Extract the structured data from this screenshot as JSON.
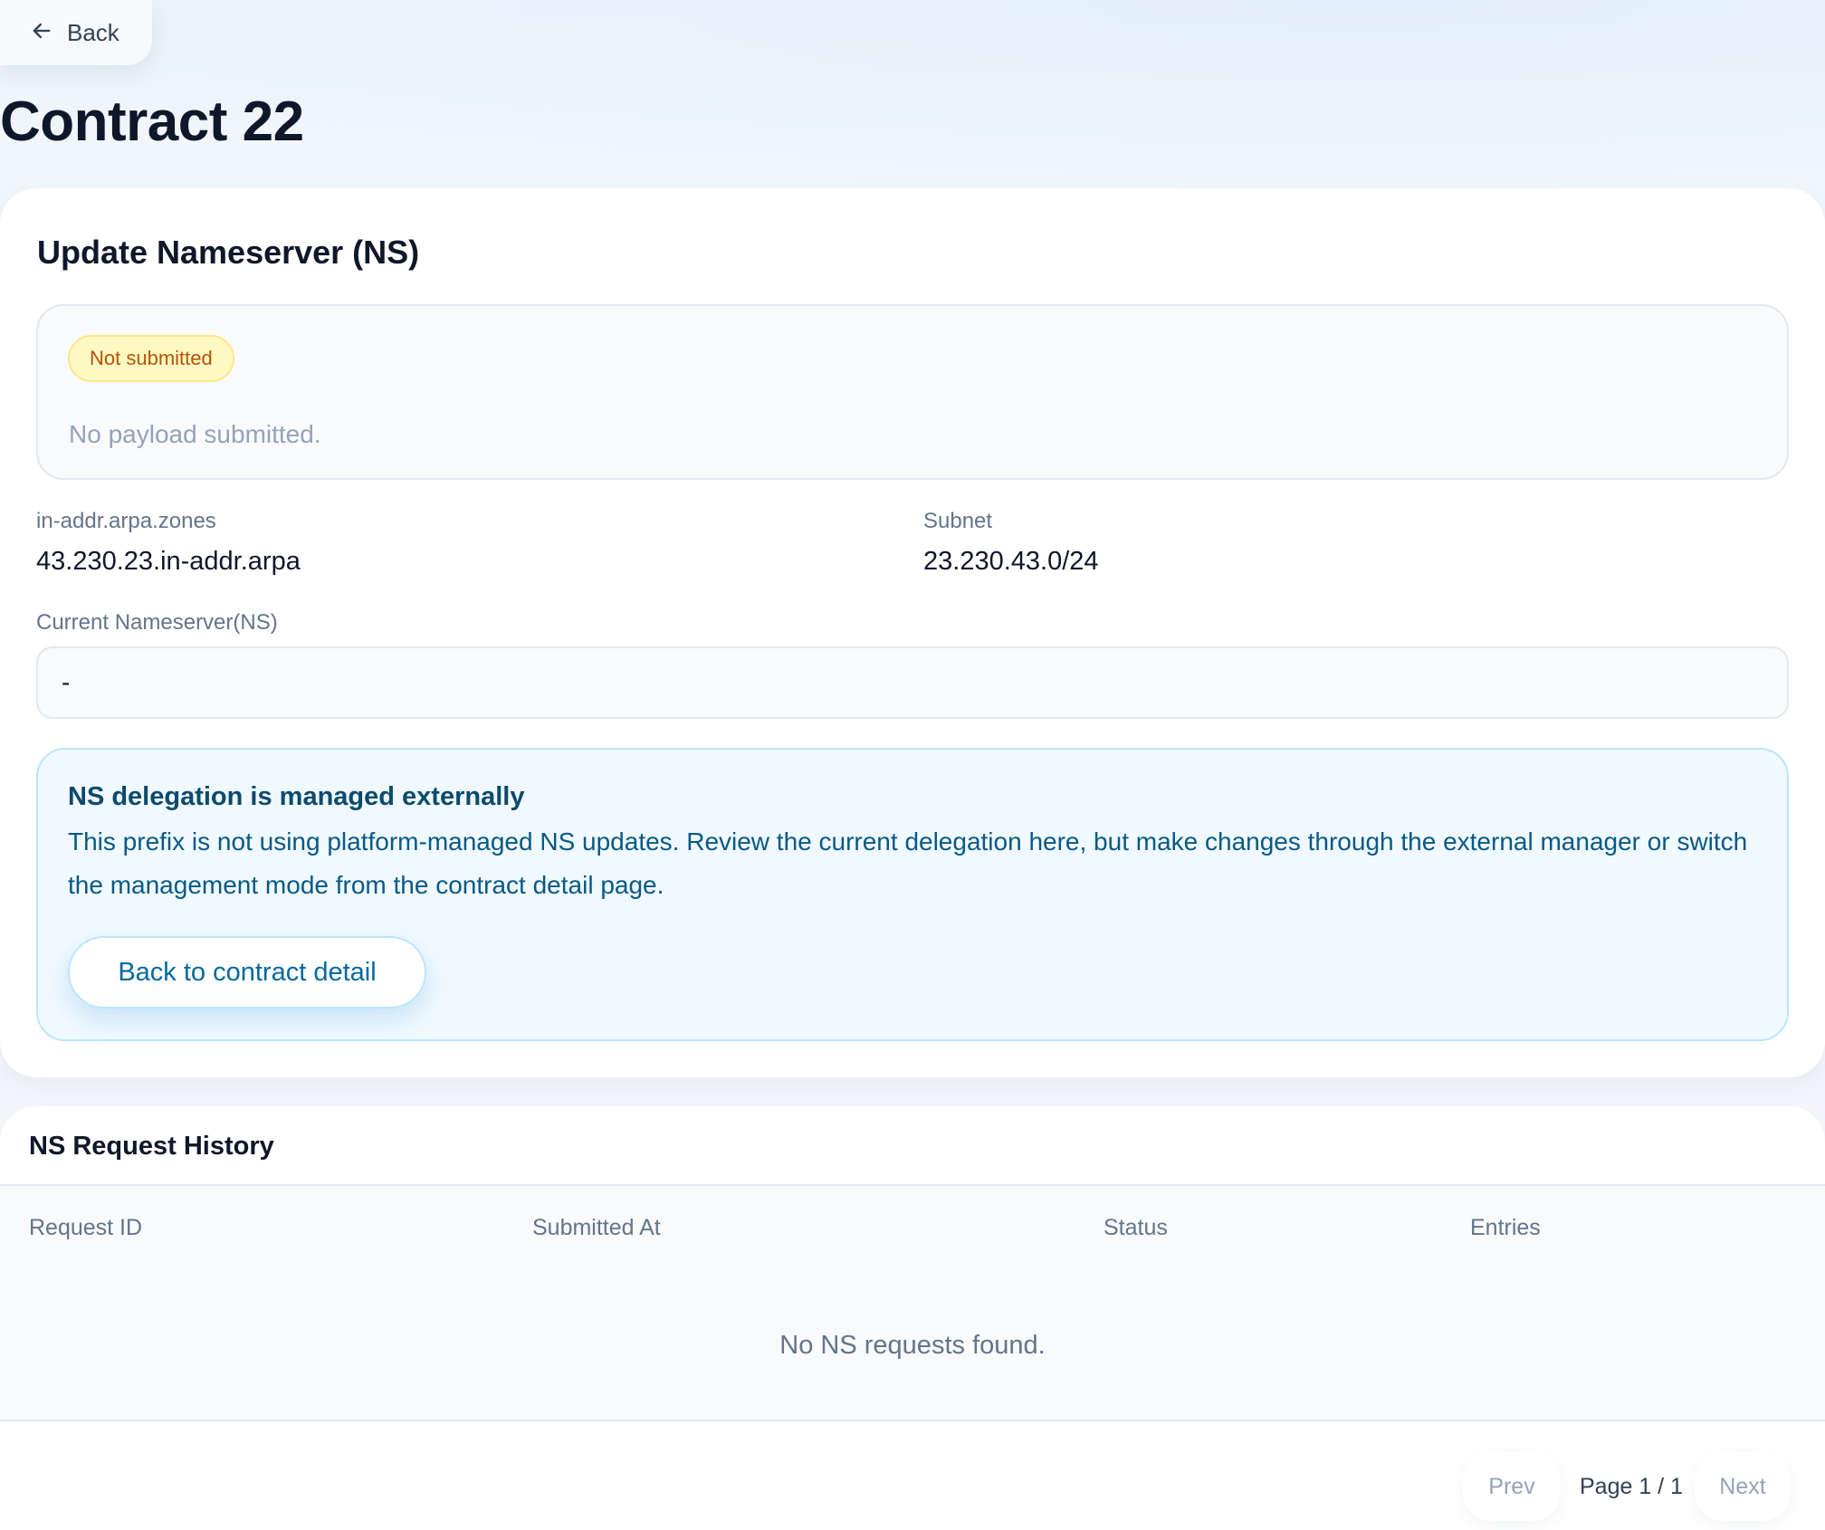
{
  "nav": {
    "back_label": "Back"
  },
  "page": {
    "title": "Contract 22"
  },
  "ns_card": {
    "title": "Update Nameserver (NS)",
    "status_badge": "Not submitted",
    "status_text": "No payload submitted.",
    "zones_label": "in-addr.arpa.zones",
    "zones_value": "43.230.23.in-addr.arpa",
    "subnet_label": "Subnet",
    "subnet_value": "23.230.43.0/24",
    "current_ns_label": "Current Nameserver(NS)",
    "current_ns_value": "-"
  },
  "notice": {
    "title": "NS delegation is managed externally",
    "body": "This prefix is not using platform-managed NS updates. Review the current delegation here, but make changes through the external manager or switch the management mode from the contract detail page.",
    "button_label": "Back to contract detail"
  },
  "history": {
    "title": "NS Request History",
    "columns": [
      "Request ID",
      "Submitted At",
      "Status",
      "Entries"
    ],
    "rows": [],
    "empty_text": "No NS requests found.",
    "pagination": {
      "prev_label": "Prev",
      "page_text": "Page 1 / 1",
      "next_label": "Next"
    }
  },
  "colors": {
    "badge_bg": "#fef9c3",
    "badge_text": "#b45309",
    "notice_bg": "#f0f9ff",
    "notice_border": "#bae6fd",
    "notice_text": "#075985",
    "link_blue": "#0369a1"
  },
  "icons": {
    "back": "arrow-left-icon"
  }
}
